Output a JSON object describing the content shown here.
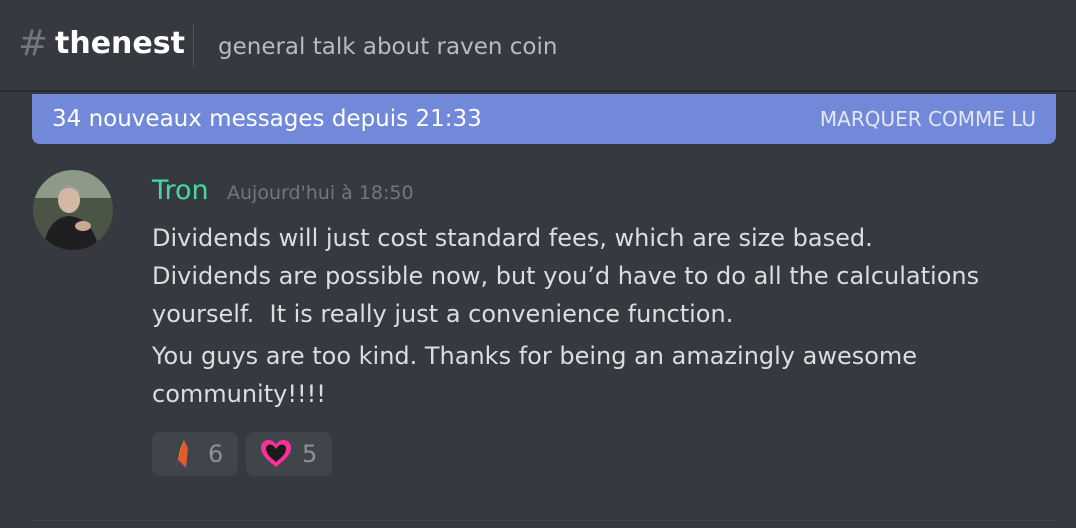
{
  "header": {
    "hash_icon": "#",
    "channel_name": "thenest",
    "topic": "general talk about raven coin"
  },
  "new_messages_bar": {
    "text": "34 nouveaux messages depuis 21:33",
    "mark_read_label": "MARQUER COMME LU",
    "color": "#7289da"
  },
  "message": {
    "avatar_icon": "user-avatar",
    "username": "Tron",
    "username_color": "#43d9a0",
    "timestamp": "Aujourd'hui à 18:50",
    "lines": [
      "Dividends will just cost standard fees, which are size based.\nDividends are possible now, but you’d have to do all the calculations\nyourself.  It is really just a convenience function.",
      "You guys are too kind. Thanks for being an amazingly awesome\ncommunity!!!!"
    ],
    "reactions": [
      {
        "emoji": "raven-coin-icon",
        "count": "6"
      },
      {
        "emoji": "heart-icon",
        "count": "5"
      }
    ]
  }
}
